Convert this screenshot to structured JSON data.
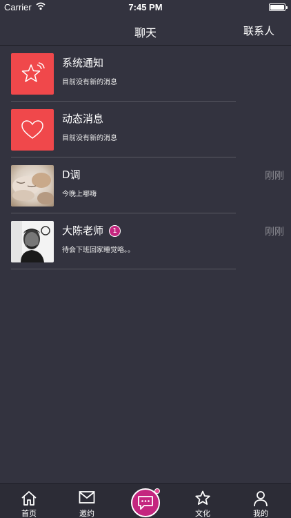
{
  "status_bar": {
    "carrier": "Carrier",
    "time": "7:45 PM"
  },
  "nav": {
    "title": "聊天",
    "right_action": "联系人"
  },
  "conversations": [
    {
      "name": "系统通知",
      "preview": "目前没有新的消息",
      "time": "",
      "badge": "",
      "avatar": "star-icon"
    },
    {
      "name": "动态消息",
      "preview": "目前没有新的消息",
      "time": "",
      "badge": "",
      "avatar": "heart-icon"
    },
    {
      "name": "D调",
      "preview": "今晚上哪嗨",
      "time": "刚刚",
      "badge": "",
      "avatar": "cat-photo"
    },
    {
      "name": "大陈老师",
      "preview": "待会下班回家睡觉咯。。",
      "time": "刚刚",
      "badge": "1",
      "avatar": "portrait-photo"
    }
  ],
  "tabbar": {
    "items": [
      {
        "label": "首页",
        "icon": "home-icon"
      },
      {
        "label": "邀约",
        "icon": "mail-icon"
      },
      {
        "label": "",
        "icon": "chat-icon"
      },
      {
        "label": "文化",
        "icon": "star-icon"
      },
      {
        "label": "我的",
        "icon": "person-icon"
      }
    ]
  },
  "colors": {
    "background": "#33333f",
    "accent_red": "#f0484b",
    "accent_magenta": "#c4267f"
  }
}
